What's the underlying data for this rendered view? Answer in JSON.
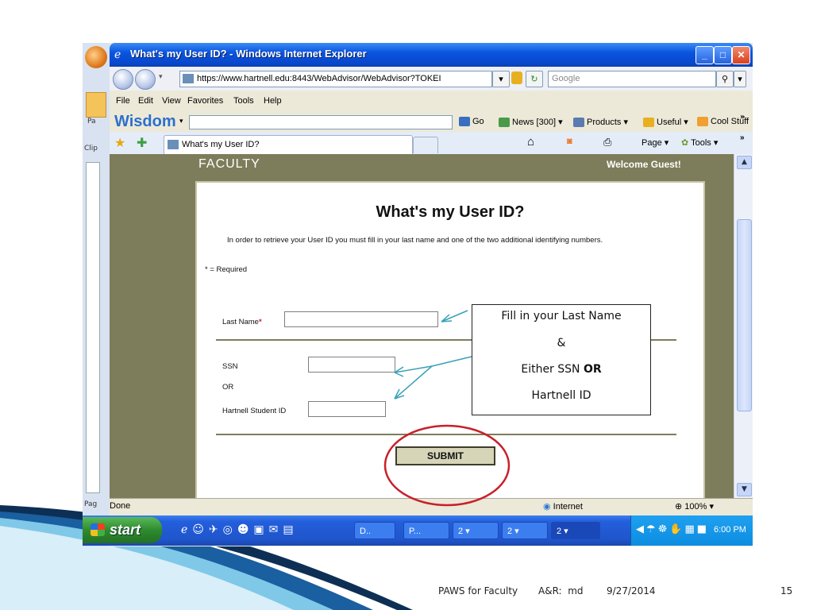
{
  "ie": {
    "title": "What's my User ID? - Windows Internet Explorer",
    "address": "https://www.hartnell.edu:8443/WebAdvisor/WebAdvisor?TOKEI",
    "search_placeholder": "Google",
    "menu": [
      "File",
      "Edit",
      "View",
      "Favorites",
      "Tools",
      "Help"
    ],
    "toolbar": {
      "brand": "Wisdom",
      "go": "Go",
      "news": "News [300]",
      "products": "Products",
      "useful": "Useful",
      "cool": "Cool Stuff"
    },
    "tab_title": "What's my User ID?",
    "cmd": {
      "page": "Page",
      "tools": "Tools"
    },
    "status": {
      "left": "Done",
      "zone": "Internet",
      "zoom": "100%"
    }
  },
  "word": {
    "paste_label": "Pa",
    "clip_label": "Clip",
    "page_label": "Pag"
  },
  "page": {
    "banner": "FACULTY",
    "welcome": "Welcome Guest!",
    "title": "What's my User ID?",
    "instructions": "In order to retrieve your User ID you must fill in your last name and one of the two additional identifying numbers.",
    "required_note": "* = Required",
    "last_name_label": "Last Name",
    "required_mark": "*",
    "ssn_label": "SSN",
    "or_label": "OR",
    "student_id_label": "Hartnell Student ID",
    "submit": "SUBMIT"
  },
  "callout": {
    "line1": "Fill in your Last Name",
    "line2": "&",
    "line3_pre": "Either SSN ",
    "line3_bold": "OR",
    "line4": "Hartnell ID"
  },
  "taskbar": {
    "start": "start",
    "tasks": [
      "D..",
      "P...",
      "2",
      "2",
      "2"
    ],
    "clock": "6:00 PM"
  },
  "footer": {
    "title": "PAWS for Faculty",
    "author": "A&R:  md",
    "date": "9/27/2014",
    "page_number": "15"
  },
  "colors": {
    "ie_title_bar": "#0a55e0",
    "page_banner": "#7e7d5b",
    "highlight_circle": "#c8202a",
    "callout_arrow": "#3aa0b8",
    "required_star": "#c8202a"
  }
}
